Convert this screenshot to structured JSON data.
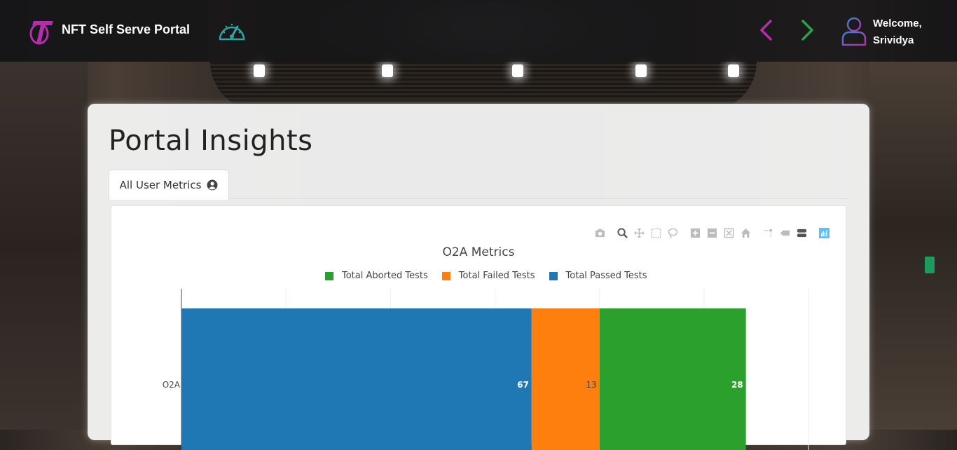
{
  "header": {
    "app_title": "NFT Self Serve Portal",
    "welcome_line1": "Welcome,",
    "welcome_line2": "Srividya",
    "colors": {
      "back": "#b12fa8",
      "forward": "#2aa247",
      "gauge": "#2aa8a0"
    }
  },
  "main": {
    "title": "Portal Insights",
    "tabs": [
      {
        "label": "All User Metrics",
        "icon": "user-circle-icon"
      }
    ]
  },
  "toolbar": {
    "icons": [
      "camera-icon",
      "zoom-icon",
      "pan-icon",
      "box-select-icon",
      "lasso-icon",
      "zoom-in-icon",
      "zoom-out-icon",
      "autoscale-icon",
      "reset-axes-icon",
      "spike-lines-icon",
      "hover-closest-icon",
      "hover-compare-icon",
      "plotly-logo-icon"
    ]
  },
  "chart_data": {
    "type": "bar",
    "orientation": "horizontal",
    "barmode": "stack",
    "title": "O2A Metrics",
    "categories": [
      "O2A"
    ],
    "series": [
      {
        "name": "Total Passed Tests",
        "values": [
          67
        ],
        "color": "#1f77b4"
      },
      {
        "name": "Total Failed Tests",
        "values": [
          13
        ],
        "color": "#ff7f0e"
      },
      {
        "name": "Total Aborted Tests",
        "values": [
          28
        ],
        "color": "#2ca02c"
      }
    ],
    "legend_order": [
      "Total Aborted Tests",
      "Total Failed Tests",
      "Total Passed Tests"
    ],
    "legend_placement": "top",
    "xlim": [
      0,
      120
    ],
    "grid": true
  }
}
